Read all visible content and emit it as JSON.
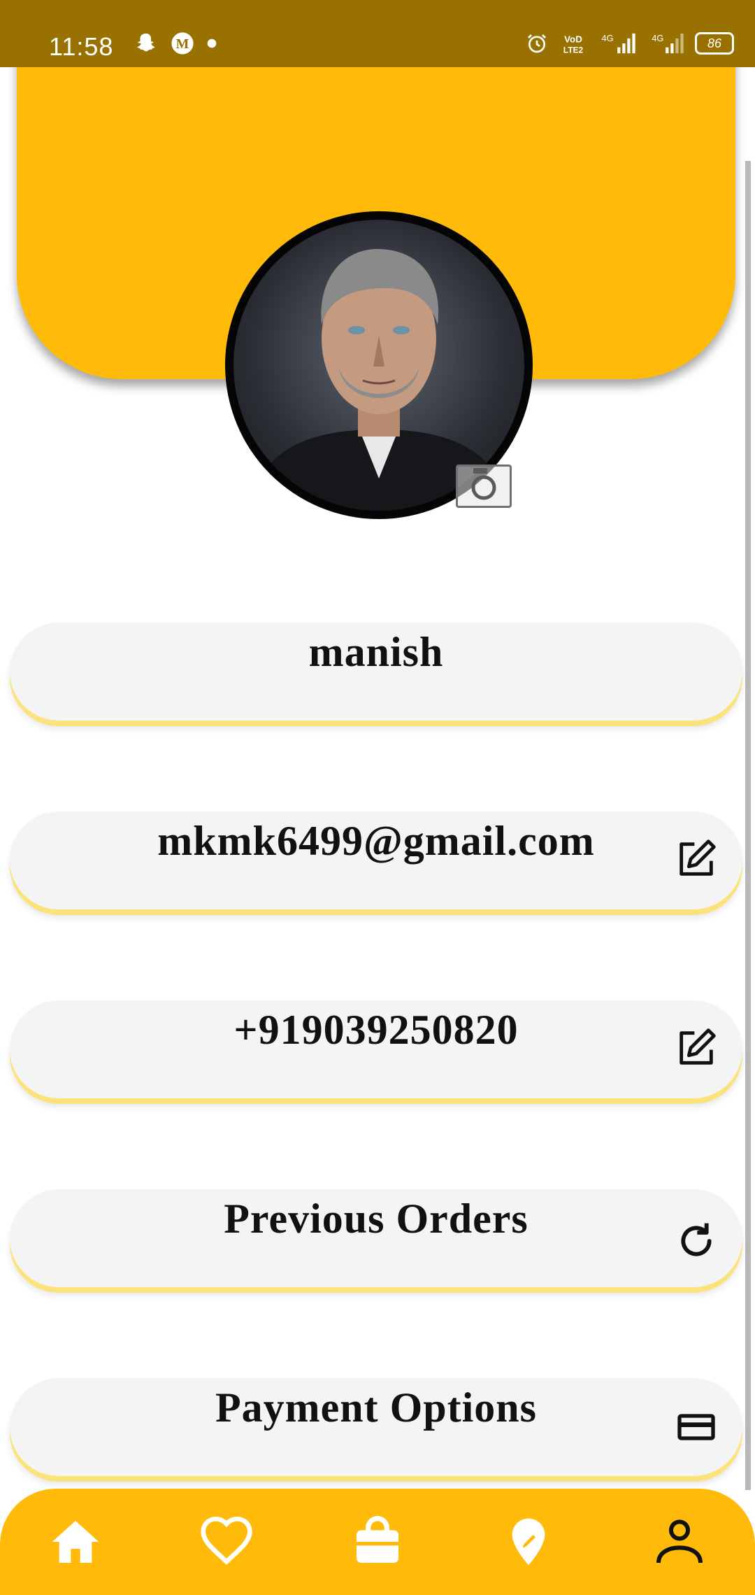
{
  "status_bar": {
    "time": "11:58",
    "left_icons": [
      "snapchat-icon",
      "medium-icon",
      "dot-icon"
    ],
    "right_icons": [
      "alarm-icon",
      "volte-icon",
      "signal-4g-icon",
      "signal-4g-icon"
    ],
    "battery": "86"
  },
  "profile": {
    "avatar": "profile-photo",
    "camera_icon": "camera-icon"
  },
  "fields": [
    {
      "text": "manish",
      "icon": ""
    },
    {
      "text": "mkmk6499@gmail.com",
      "icon": "edit-icon"
    },
    {
      "text": "+919039250820",
      "icon": "edit-icon"
    },
    {
      "text": "Previous Orders",
      "icon": "refresh-icon"
    },
    {
      "text": "Payment Options",
      "icon": "credit-card-icon"
    }
  ],
  "bottom_nav": {
    "items": [
      "home-icon",
      "heart-icon",
      "shopping-bag-icon",
      "location-pin-icon",
      "person-icon"
    ]
  },
  "colors": {
    "accent": "#ffba0a",
    "status_bar": "#987100",
    "card_bg": "#f4f4f4",
    "card_underline": "#fbe27a"
  }
}
